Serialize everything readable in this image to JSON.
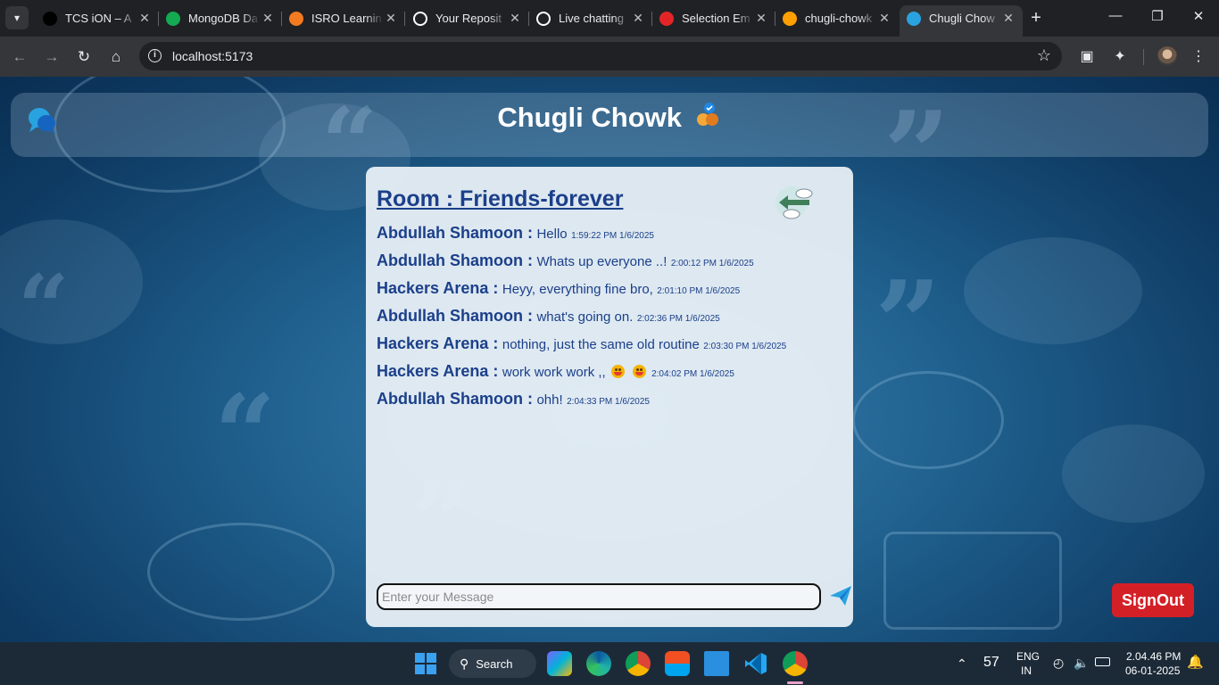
{
  "browser": {
    "tabs": [
      {
        "title": "TCS iON – A",
        "icon": "tcs-icon",
        "color": "#000000"
      },
      {
        "title": "MongoDB Da",
        "icon": "mongodb-icon",
        "color": "#13aa52"
      },
      {
        "title": "ISRO Learnin",
        "icon": "isro-icon",
        "color": "#f47a20"
      },
      {
        "title": "Your Reposit",
        "icon": "github-icon",
        "color": "#ffffff"
      },
      {
        "title": "Live chatting",
        "icon": "openai-icon",
        "color": "#ffffff"
      },
      {
        "title": "Selection Em",
        "icon": "zoho-icon",
        "color": "#e42527"
      },
      {
        "title": "chugli-chowk",
        "icon": "firebase-icon",
        "color": "#ffa000"
      },
      {
        "title": "Chugli Chow",
        "icon": "chat-bubbles-icon",
        "color": "#29a3e0",
        "active": true
      }
    ],
    "url": "localhost:5173"
  },
  "app": {
    "title": "Chugli Chowk",
    "room_label": "Room : Friends-forever",
    "messages": [
      {
        "sender": "Abdullah Shamoon :",
        "text": "Hello",
        "time": "1:59:22 PM 1/6/2025"
      },
      {
        "sender": "Abdullah Shamoon :",
        "text": "Whats up everyone ..!",
        "time": "2:00:12 PM 1/6/2025"
      },
      {
        "sender": "Hackers Arena :",
        "text": "Heyy, everything fine bro,",
        "time": "2:01:10 PM 1/6/2025"
      },
      {
        "sender": "Abdullah Shamoon :",
        "text": "what's going on.",
        "time": "2:02:36 PM 1/6/2025"
      },
      {
        "sender": "Hackers Arena :",
        "text": "nothing, just the same old routine",
        "time": "2:03:30 PM 1/6/2025"
      },
      {
        "sender": "Hackers Arena :",
        "text": "work work work ,,",
        "emoji_count": 2,
        "time": "2:04:02 PM 1/6/2025"
      },
      {
        "sender": "Abdullah Shamoon :",
        "text": "ohh!",
        "time": "2:04:33 PM 1/6/2025"
      }
    ],
    "input_placeholder": "Enter your Message",
    "input_value": "",
    "signout_label": "SignOut",
    "colors": {
      "accent_text": "#1b3f8a",
      "signout": "#d32027",
      "send": "#29a3e0"
    }
  },
  "taskbar": {
    "search_label": "Search",
    "apps": [
      "windows-start-icon",
      "copilot-icon",
      "edge-icon",
      "chrome-icon",
      "store-icon",
      "remote-desktop-icon",
      "vscode-icon",
      "chrome-profile-icon"
    ],
    "temperature": "57",
    "lang_line1": "ENG",
    "lang_line2": "IN",
    "time": "2.04.46 PM",
    "date": "06-01-2025"
  }
}
